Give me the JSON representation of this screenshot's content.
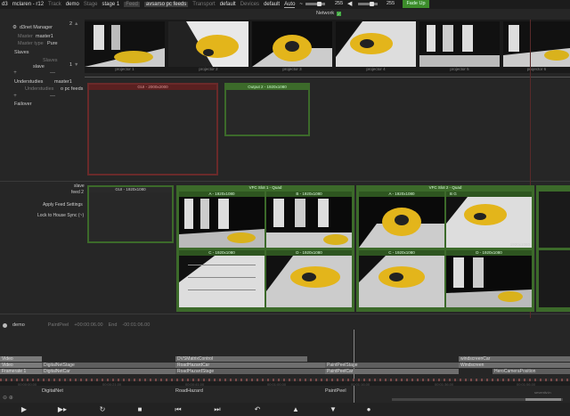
{
  "topbar": {
    "d3_label": "d3",
    "project": "mclaren - r12",
    "track_label": "Track",
    "track_value": "demo",
    "stage_label": "Stage",
    "stage_value": "stage 1",
    "feed_label": "Feed",
    "feed_value": "avsarso pc feeds",
    "transport_label": "Transport",
    "transport_value": "default",
    "devices_label": "Devices",
    "devices_value": "default",
    "auto_label": "Auto",
    "auto_icon": "~",
    "volume_value": "255",
    "volume_level": 0.78,
    "brightness_value": "255",
    "brightness_level": 0.78,
    "fade_up": "Fade Up"
  },
  "network": {
    "label": "Network",
    "check": "✓"
  },
  "left": {
    "manager_title": "d3net Manager",
    "master_label": "Master",
    "master_value": "master1",
    "master_type_label": "Master type",
    "master_type_value": "Pure",
    "slaves_label": "Slaves",
    "slaves_sub": "Slaves",
    "slave_item": "slave",
    "understudies_label": "Understudies",
    "understudies_sub": "Understudies",
    "understudy_item": "master1",
    "failover_label": "Failover",
    "pager_top": "2",
    "pager_bottom": "1",
    "plus": "+",
    "minus": "—",
    "pc_feeds": "o pc feeds",
    "slave_tag": "slave",
    "feed_tag": "feed 2",
    "apply_feed": "Apply Feed Settings",
    "lock_house": "Lock to House Sync (~)"
  },
  "projectors": [
    {
      "label": "projector 1"
    },
    {
      "label": "projector 2"
    },
    {
      "label": "projector 3"
    },
    {
      "label": "projector 4"
    },
    {
      "label": "projector 5"
    },
    {
      "label": "projector 6"
    }
  ],
  "outputs": {
    "gui_top": "GUI - 2000x2000",
    "output2": "Output 2 - 1920x1080",
    "gui_bottom": "GUI - 1920x1080",
    "vfc1": "VFC Slot 1 - Quad",
    "vfc2": "VFC Slot 2 - Quad",
    "a1": "A - 1920x1080",
    "b1": "B - 1920x1080",
    "c1": "C - 1920x1080",
    "d1": "D - 1920x1080",
    "a2": "A - 1920x1080",
    "b2": "B G",
    "c2": "C - 1920x1080",
    "d2": "D - 1920x1080",
    "res_corner": "1920x1080"
  },
  "timeline": {
    "track_name": "demo",
    "paintpeel_label": "PaintPeel",
    "start_time": "+00:00:06.00",
    "end_label": "End",
    "end_time": "-00:01:06.00",
    "layers": [
      {
        "a": "Video",
        "b": "DVSMatrixControl",
        "c": "windscreenCar"
      },
      {
        "a": "Video",
        "b": "DigitalNetStage",
        "c": "RoadHazardCar",
        "d": "PaintPeelStage",
        "e": "Windscreen"
      },
      {
        "a": "Framerate 1",
        "b": "DigitalNetCar",
        "c": "RoadHazardStage",
        "d": "PaintPeelCar",
        "e": "HeroCameraPosition"
      }
    ],
    "ruler": [
      "00:00:00.00",
      "00:00:21.00",
      "00:00:41.00",
      "00:01:00.00",
      "00:01:16.00",
      "00:01:36.00",
      "00:01:56.00"
    ],
    "markers": [
      "DigitalNet",
      "RoadHazard",
      "PaintPeel"
    ],
    "zoom": "⊖ ⊕",
    "scrub_label": "seventiv.in"
  },
  "transport": {
    "play": "▶",
    "play_next": "▶▸",
    "loop": "↻",
    "stop": "■",
    "prev_section": "⏮",
    "next_section": "⏭",
    "undo": "↶",
    "up": "▲",
    "down": "▼",
    "record": "●"
  }
}
